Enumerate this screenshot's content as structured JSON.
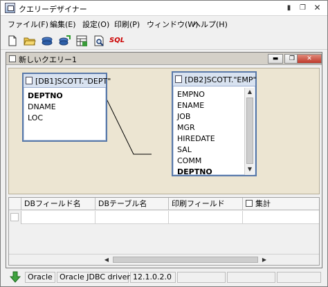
{
  "window": {
    "title": "クエリーデザイナー",
    "controls": [
      "minimize",
      "restore",
      "close"
    ]
  },
  "menu": {
    "items": [
      {
        "label": "ファイル(F)"
      },
      {
        "label": "編集(E)"
      },
      {
        "label": "設定(O)"
      },
      {
        "label": "印刷(P)"
      },
      {
        "label": "ウィンドウ(W)"
      },
      {
        "label": "ヘルプ(H)"
      }
    ]
  },
  "toolbar": {
    "icons": [
      "new-file-icon",
      "open-folder-icon",
      "database-icon",
      "connect-database-icon",
      "table-add-icon",
      "print-preview-icon",
      "sql-icon"
    ],
    "sql_label": "SQL",
    "colors": {
      "sql": "#cc0000",
      "folder": "#e8c14a",
      "db": "#2e5fa8"
    }
  },
  "child": {
    "title": "新しいクエリー1"
  },
  "tables": [
    {
      "title": "[DB1]SCOTT.\"DEPT\"",
      "fields": [
        {
          "name": "DEPTNO",
          "key": true
        },
        {
          "name": "DNAME",
          "key": false
        },
        {
          "name": "LOC",
          "key": false
        }
      ]
    },
    {
      "title": "[DB2]SCOTT.\"EMP\"",
      "fields": [
        {
          "name": "EMPNO",
          "key": false
        },
        {
          "name": "ENAME",
          "key": false
        },
        {
          "name": "JOB",
          "key": false
        },
        {
          "name": "MGR",
          "key": false
        },
        {
          "name": "HIREDATE",
          "key": false
        },
        {
          "name": "SAL",
          "key": false
        },
        {
          "name": "COMM",
          "key": false
        },
        {
          "name": "DEPTNO",
          "key": true
        }
      ]
    }
  ],
  "grid": {
    "headers": [
      "DBフィールド名",
      "DBテーブル名",
      "印刷フィールド",
      "集計"
    ],
    "rows": [
      [
        "",
        "",
        "",
        ""
      ]
    ]
  },
  "status": {
    "cells": [
      "Oracle",
      "Oracle JDBC driver",
      "12.1.0.2.0"
    ]
  },
  "colors": {
    "canvas": "#ece5d2",
    "table_border": "#5878a8",
    "status_icon": "#3fa33f"
  }
}
